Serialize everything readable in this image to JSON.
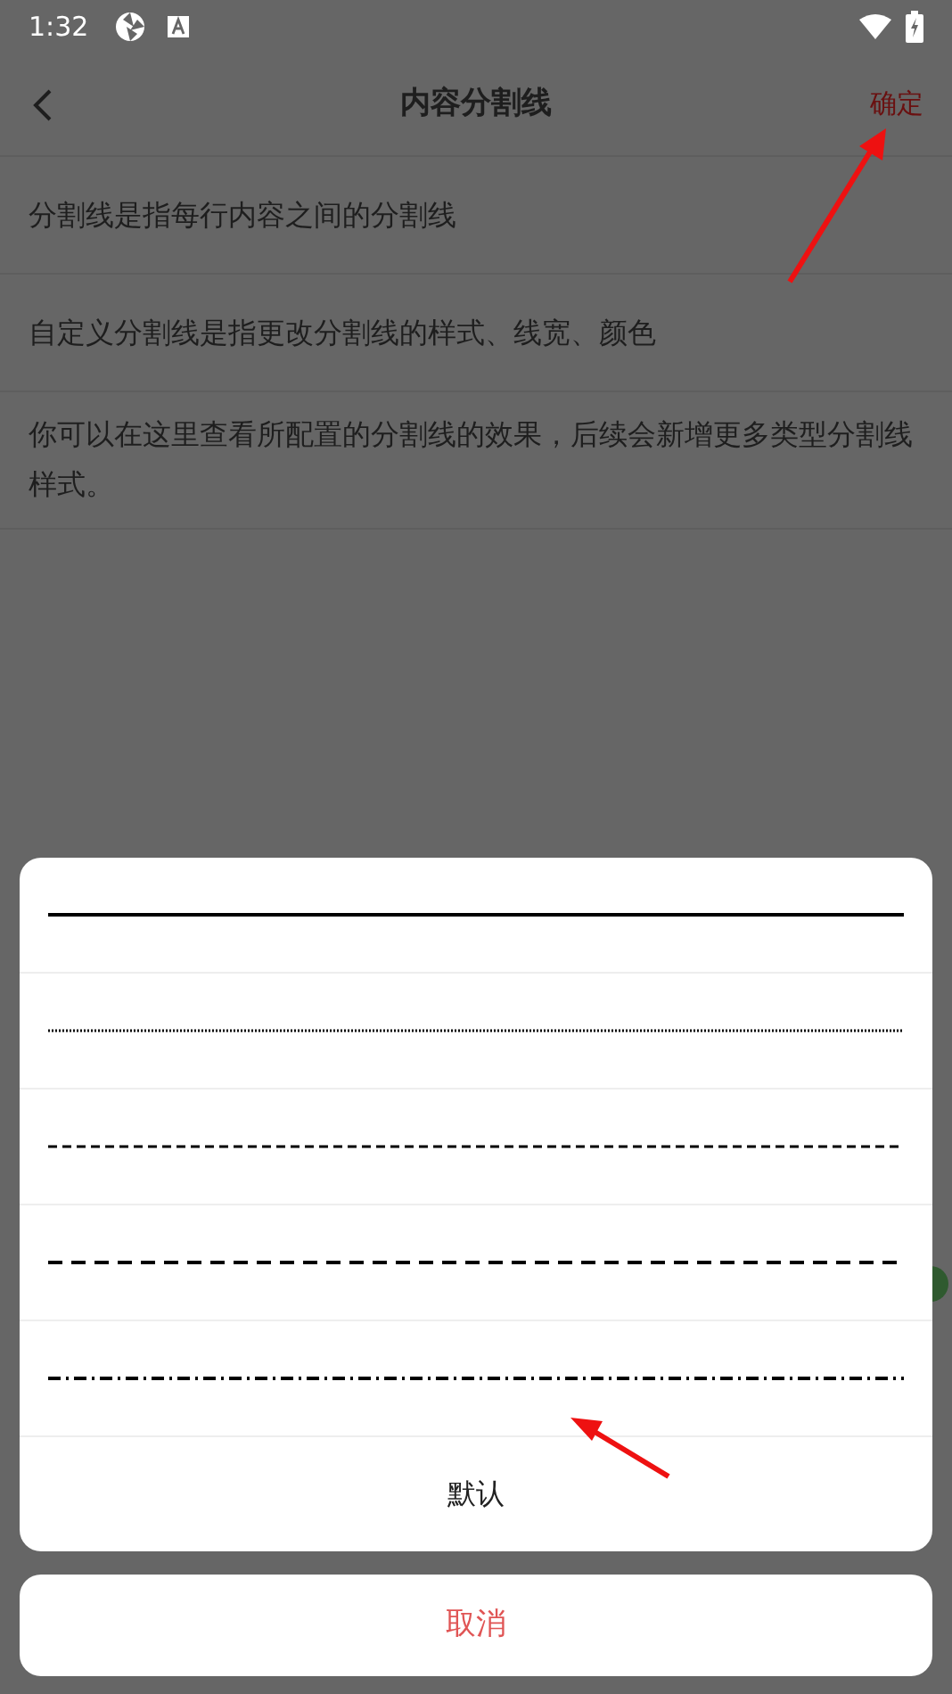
{
  "status_bar": {
    "time": "1:32"
  },
  "header": {
    "title": "内容分割线",
    "confirm": "确定"
  },
  "rows": [
    {
      "text": "分割线是指每行内容之间的分割线"
    },
    {
      "text": "自定义分割线是指更改分割线的样式、线宽、颜色"
    },
    {
      "text": "你可以在这里查看所配置的分割线的效果，后续会新增更多类型分割线样式。"
    }
  ],
  "sheet": {
    "options": [
      {
        "kind": "solid"
      },
      {
        "kind": "dotted"
      },
      {
        "kind": "dashed"
      },
      {
        "kind": "longdash"
      },
      {
        "kind": "dashdot"
      }
    ],
    "default_label": "默认",
    "cancel": "取消"
  }
}
